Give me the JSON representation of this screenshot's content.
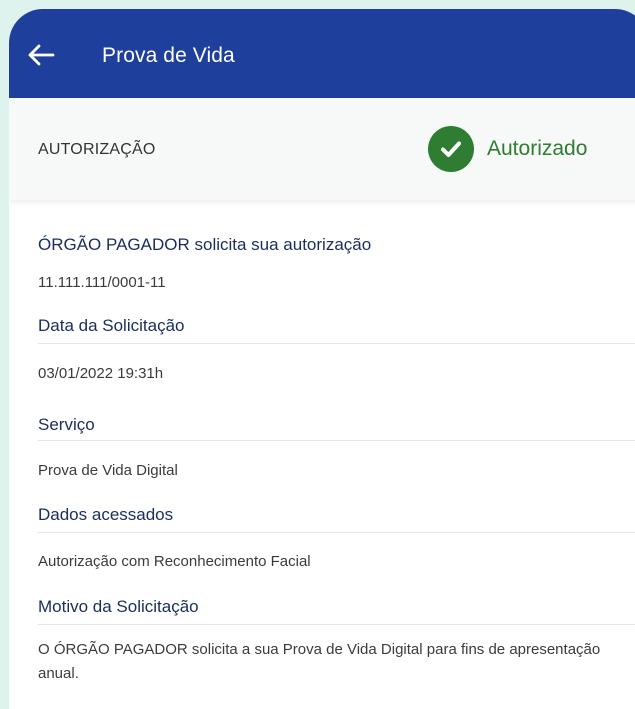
{
  "app_bar": {
    "title": "Prova de Vida",
    "back_icon": "arrow-left-icon",
    "background_color": "#1f3f9c"
  },
  "authorization": {
    "label": "AUTORIZAÇÃO",
    "status_text": "Autorizado",
    "status_icon": "check-circle-icon",
    "status_color": "#2e7d32"
  },
  "details": {
    "requester": {
      "title": "ÓRGÃO PAGADOR solicita sua autorização",
      "value": "11.111.111/0001-11"
    },
    "request_date": {
      "title": "Data da Solicitação",
      "value": "03/01/2022 19:31h"
    },
    "service": {
      "title": "Serviço",
      "value": "Prova de Vida Digital"
    },
    "accessed_data": {
      "title": "Dados acessados",
      "value": "Autorização com Reconhecimento Facial"
    },
    "reason": {
      "title": "Motivo da Solicitação",
      "value": "O ÓRGÃO PAGADOR solicita a sua Prova de Vida Digital para fins de apresentação anual."
    }
  }
}
